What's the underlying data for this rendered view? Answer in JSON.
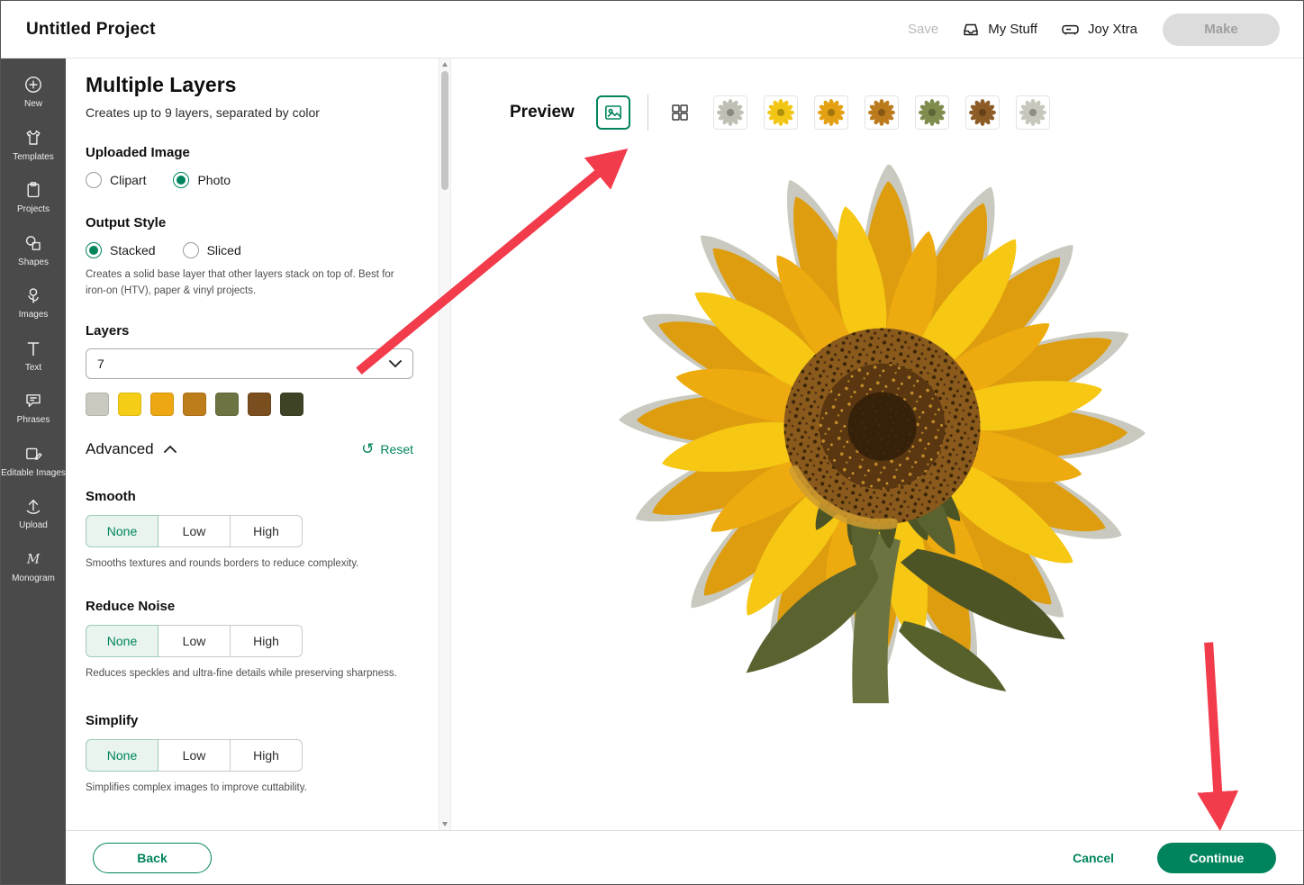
{
  "colors": {
    "accent": "#00845e",
    "accentLight": "#e9f4ee",
    "arrow": "#f23b4b",
    "sidebarBg": "#4a4a4a",
    "disabledText": "#b9b9b9"
  },
  "header": {
    "title": "Untitled Project",
    "save": "Save",
    "my_stuff": "My Stuff",
    "machine": "Joy Xtra",
    "make": "Make"
  },
  "sidebar": {
    "items": [
      {
        "label": "New"
      },
      {
        "label": "Templates"
      },
      {
        "label": "Projects"
      },
      {
        "label": "Shapes"
      },
      {
        "label": "Images"
      },
      {
        "label": "Text"
      },
      {
        "label": "Phrases"
      },
      {
        "label": "Editable Images"
      },
      {
        "label": "Upload"
      },
      {
        "label": "Monogram"
      }
    ]
  },
  "panel": {
    "title": "Multiple Layers",
    "subtitle": "Creates up to 9 layers, separated by color",
    "uploaded_image": {
      "label": "Uploaded Image",
      "clipart": "Clipart",
      "photo": "Photo",
      "selected": "Photo"
    },
    "output_style": {
      "label": "Output Style",
      "stacked": "Stacked",
      "sliced": "Sliced",
      "selected": "Stacked",
      "description": "Creates a solid base layer that other layers stack on top of. Best for iron-on (HTV), paper & vinyl projects."
    },
    "layers": {
      "label": "Layers",
      "value": "7",
      "swatches": [
        "#c9c9bf",
        "#f5cd16",
        "#eda713",
        "#bd7d1b",
        "#6d7442",
        "#7b4e1f",
        "#3f4326"
      ]
    },
    "advanced": "Advanced",
    "reset": "Reset",
    "smooth": {
      "label": "Smooth",
      "options": [
        "None",
        "Low",
        "High"
      ],
      "selected": "None",
      "description": "Smooths textures and rounds borders to reduce complexity."
    },
    "reduce_noise": {
      "label": "Reduce Noise",
      "options": [
        "None",
        "Low",
        "High"
      ],
      "selected": "None",
      "description": "Reduces speckles and ultra-fine details while preserving sharpness."
    },
    "simplify": {
      "label": "Simplify",
      "options": [
        "None",
        "Low",
        "High"
      ],
      "selected": "None",
      "description": "Simplifies complex images to improve cuttability."
    }
  },
  "preview": {
    "label": "Preview",
    "image": "sunflower",
    "thumbnails": [
      {
        "color": "#bfbfb4"
      },
      {
        "color": "#f2c614"
      },
      {
        "color": "#e2a012"
      },
      {
        "color": "#bb7a1c"
      },
      {
        "color": "#7e8d4d"
      },
      {
        "color": "#8d5c26"
      },
      {
        "color": "#c7c7bc"
      }
    ]
  },
  "footer": {
    "back": "Back",
    "cancel": "Cancel",
    "continue": "Continue"
  }
}
